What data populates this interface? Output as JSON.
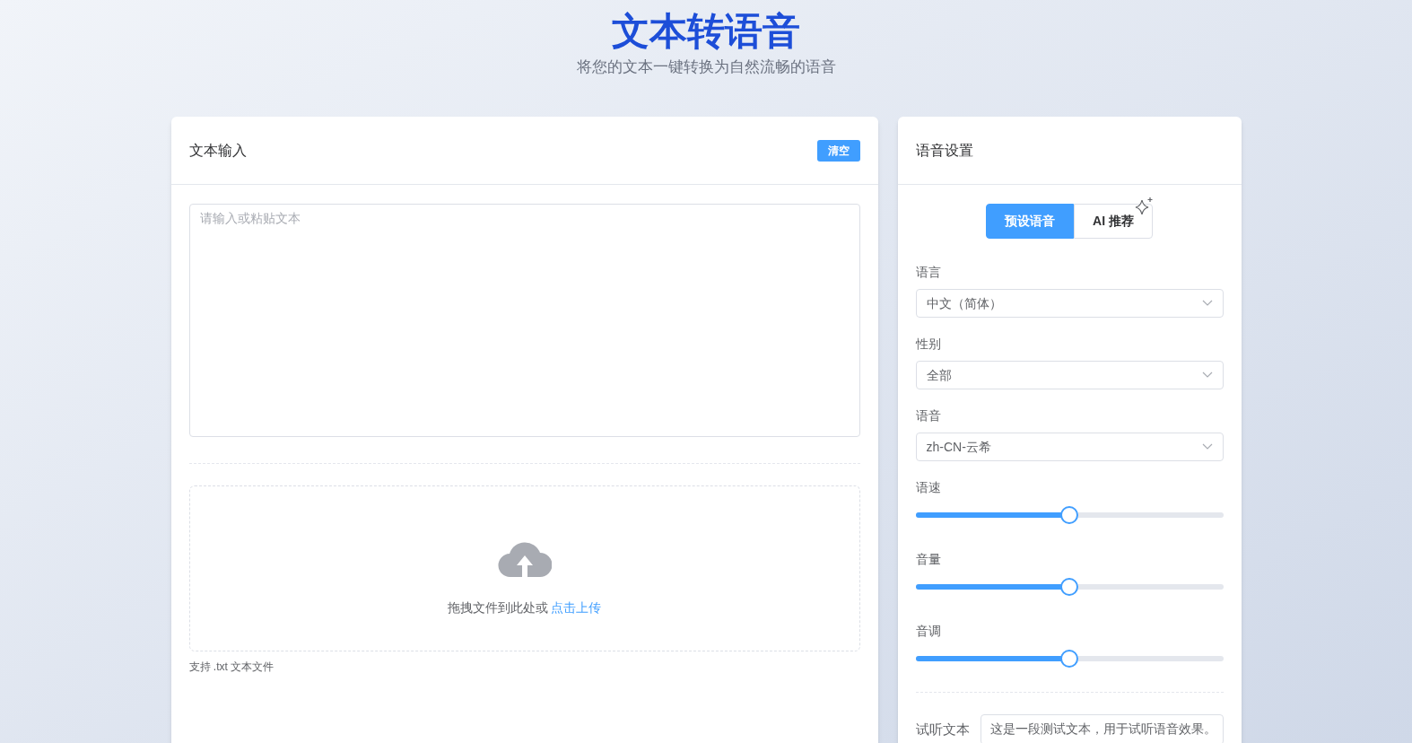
{
  "header": {
    "title": "文本转语音",
    "subtitle": "将您的文本一键转换为自然流畅的语音"
  },
  "text_input": {
    "title": "文本输入",
    "clear_button": "清空",
    "textarea": {
      "placeholder": "请输入或粘贴文本"
    },
    "upload": {
      "prompt": "拖拽文件到此处或",
      "link": "点击上传"
    },
    "hint": "支持 .txt 文本文件"
  },
  "voice_settings": {
    "title": "语音设置",
    "tabs": [
      {
        "label": "预设语音",
        "selected": true
      },
      {
        "label": "AI 推荐",
        "selected": false
      }
    ],
    "fields": [
      {
        "kind": "select",
        "label": "语言",
        "value": "中文（简体）"
      },
      {
        "kind": "select",
        "label": "性别",
        "value": "全部"
      },
      {
        "kind": "select",
        "label": "语音",
        "value": "zh-CN-云希"
      },
      {
        "kind": "slider",
        "label": "语速",
        "level": 0.5
      },
      {
        "kind": "slider",
        "label": "音量",
        "level": 0.5
      },
      {
        "kind": "slider",
        "label": "音调",
        "level": 0.5
      }
    ],
    "preview": {
      "label": "试听文本",
      "value": "这是一段测试文本，用于试听语音效果。"
    }
  }
}
